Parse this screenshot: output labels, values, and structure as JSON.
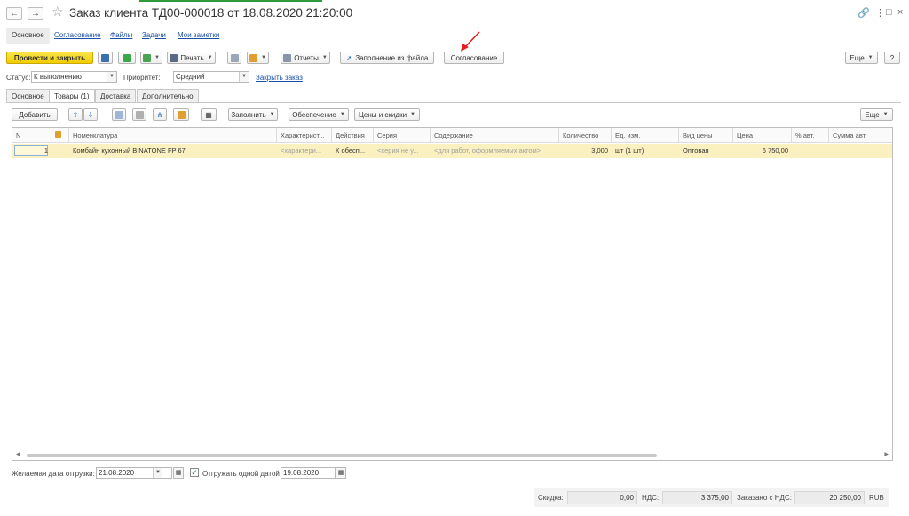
{
  "window": {
    "title": "Заказ клиента ТД00-000018 от 18.08.2020 21:20:00",
    "back_icon": "arrow-left-icon",
    "forward_icon": "arrow-right-icon",
    "link_icon": "link-icon",
    "menu_icon": "more-vertical-icon",
    "maximize_icon": "maximize-icon",
    "close_icon": "close-icon"
  },
  "section_tabs": [
    "Основное",
    "Согласование",
    "Файлы",
    "Задачи",
    "Мои заметки"
  ],
  "toolbar": {
    "post_close": "Провести и закрыть",
    "print": "Печать",
    "reports": "Отчеты",
    "fill_from_file": "Заполнение из файла",
    "approval": "Согласование",
    "more": "Еще",
    "help": "?"
  },
  "status": {
    "status_label": "Статус:",
    "status_value": "К выполнению",
    "priority_label": "Приоритет:",
    "priority_value": "Средний",
    "close_order_link": "Закрыть заказ"
  },
  "page_tabs": [
    "Основное",
    "Товары (1)",
    "Доставка",
    "Дополнительно"
  ],
  "goods_toolbar": {
    "add": "Добавить",
    "fill": "Заполнить",
    "provision": "Обеспечение",
    "prices_discounts": "Цены и скидки",
    "more": "Еще"
  },
  "table": {
    "columns": [
      "N",
      "",
      "Номенклатура",
      "Характерист...",
      "Действия",
      "Серия",
      "Содержание",
      "Количество",
      "Ед. изм.",
      "Вид цены",
      "Цена",
      "% авт.",
      "Сумма авт."
    ],
    "rows": [
      [
        "1",
        "",
        "Комбайн кухонный BINATONE FP 67",
        "<характери...",
        "К обесп...",
        "<серия не у...",
        "<для работ, оформляемых актом>",
        "3,000",
        "шт (1 шт)",
        "Оптовая",
        "6 750,00",
        "",
        ""
      ]
    ]
  },
  "footer": {
    "desired_date_label": "Желаемая дата отгрузки:",
    "desired_date": "21.08.2020",
    "ship_one_date_label": "Отгружать одной датой",
    "ship_one_date_checked": true,
    "ship_date": "19.08.2020"
  },
  "totals": {
    "discount_label": "Скидка:",
    "discount": "0,00",
    "vat_label": "НДС:",
    "vat": "3 375,00",
    "ordered_label": "Заказано с НДС:",
    "ordered": "20 250,00",
    "currency": "RUB"
  },
  "colors": {
    "accent_yellow": "#f0cd00",
    "row_highlight": "#fbf0c0",
    "link_blue": "#1a4fa6",
    "annotation_red": "#e02020"
  }
}
